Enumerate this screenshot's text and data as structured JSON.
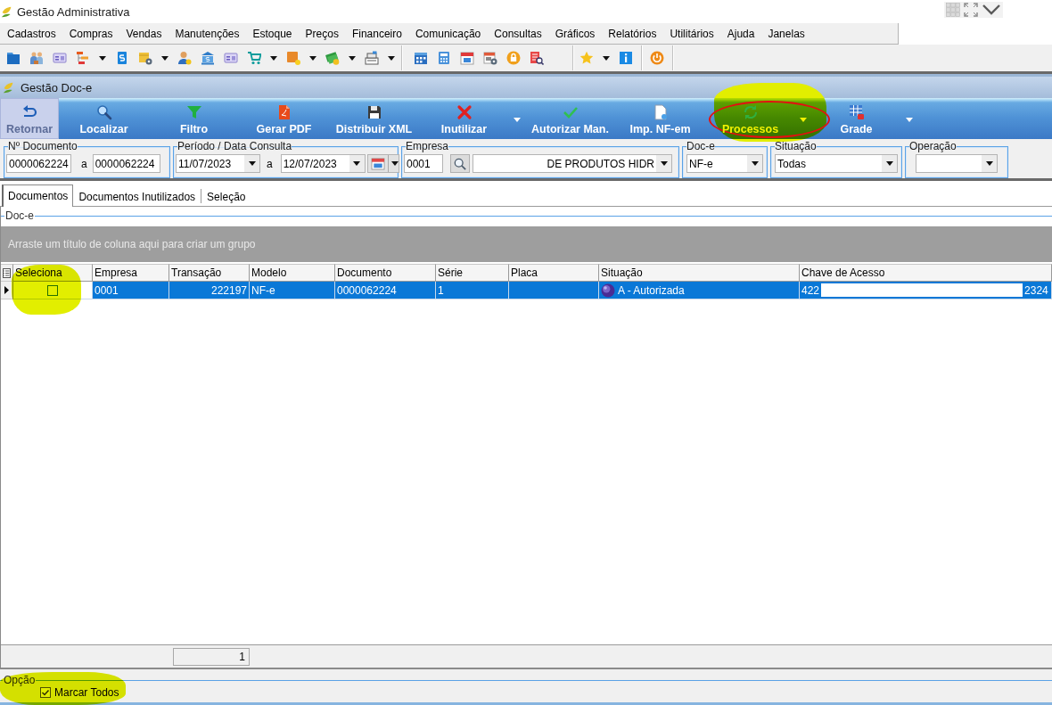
{
  "window": {
    "title": "Gestão Administrativa"
  },
  "menu": [
    "Cadastros",
    "Compras",
    "Vendas",
    "Manutenções",
    "Estoque",
    "Preços",
    "Financeiro",
    "Comunicação",
    "Consultas",
    "Gráficos",
    "Relatórios",
    "Utilitários",
    "Ajuda",
    "Janelas"
  ],
  "doc_window": {
    "title": "Gestão Doc-e",
    "actions": [
      {
        "label": "Retornar",
        "disabled": true,
        "dropdown": false,
        "highlighted": false,
        "circled": false
      },
      {
        "label": "Localizar",
        "disabled": false,
        "dropdown": false,
        "highlighted": false,
        "circled": false
      },
      {
        "label": "Filtro",
        "disabled": false,
        "dropdown": false,
        "highlighted": false,
        "circled": false
      },
      {
        "label": "Gerar PDF",
        "disabled": false,
        "dropdown": false,
        "highlighted": false,
        "circled": false
      },
      {
        "label": "Distribuir XML",
        "disabled": false,
        "dropdown": false,
        "highlighted": false,
        "circled": false
      },
      {
        "label": "Inutilizar",
        "disabled": false,
        "dropdown": true,
        "highlighted": false,
        "circled": false
      },
      {
        "label": "Autorizar Man.",
        "disabled": false,
        "dropdown": false,
        "highlighted": false,
        "circled": false
      },
      {
        "label": "Imp. NF-em",
        "disabled": false,
        "dropdown": false,
        "highlighted": false,
        "circled": false
      },
      {
        "label": "Processos",
        "disabled": false,
        "dropdown": true,
        "highlighted": true,
        "circled": true
      },
      {
        "label": "Grade",
        "disabled": false,
        "dropdown": true,
        "highlighted": false,
        "circled": false
      }
    ],
    "filters": [
      {
        "kind": "range",
        "label": "Nº Documento",
        "from": "0000062224",
        "separator": "a",
        "to": "0000062224"
      },
      {
        "kind": "date_range",
        "label": "Período / Data Consulta",
        "from": "11/07/2023",
        "separator": "a",
        "to": "12/07/2023"
      },
      {
        "kind": "lookup",
        "label": "Empresa",
        "code": "0001",
        "name": "DE PRODUTOS HIDR"
      },
      {
        "kind": "select",
        "label": "Doc-e",
        "value": "NF-e"
      },
      {
        "kind": "select",
        "label": "Situação",
        "value": "Todas"
      },
      {
        "kind": "select",
        "label": "Operação"
      }
    ],
    "tabs": [
      {
        "label": "Documentos",
        "selected": true
      },
      {
        "label": "Documentos Inutilizados",
        "selected": false
      },
      {
        "label": "Seleção",
        "selected": false
      }
    ],
    "grid": {
      "group_label": "Doc-e",
      "group_hint": "Arraste um título de coluna aqui para criar um grupo",
      "columns": [
        {
          "label": "Seleciona",
          "highlighted": true
        },
        {
          "label": "Empresa",
          "highlighted": false
        },
        {
          "label": "Transação",
          "highlighted": false
        },
        {
          "label": "Modelo",
          "highlighted": false
        },
        {
          "label": "Documento",
          "highlighted": false
        },
        {
          "label": "Série",
          "highlighted": false
        },
        {
          "label": "Placa",
          "highlighted": false
        },
        {
          "label": "Situação",
          "highlighted": false
        },
        {
          "label": "Chave de Acesso",
          "highlighted": false
        }
      ],
      "rows": [
        {
          "selected": true,
          "checked": false,
          "empresa": "0001",
          "transacao": "222197",
          "modelo": "NF-e",
          "documento": "0000062224",
          "serie": "1",
          "situacao": "A - Autorizada",
          "chave_acesso": {
            "start": "422",
            "end": "2324",
            "redacted": true
          }
        }
      ],
      "footer_count": "1"
    },
    "option": {
      "label": "Opção",
      "checkbox": {
        "label": "Marcar Todos",
        "checked": true,
        "highlighted": true
      }
    }
  }
}
